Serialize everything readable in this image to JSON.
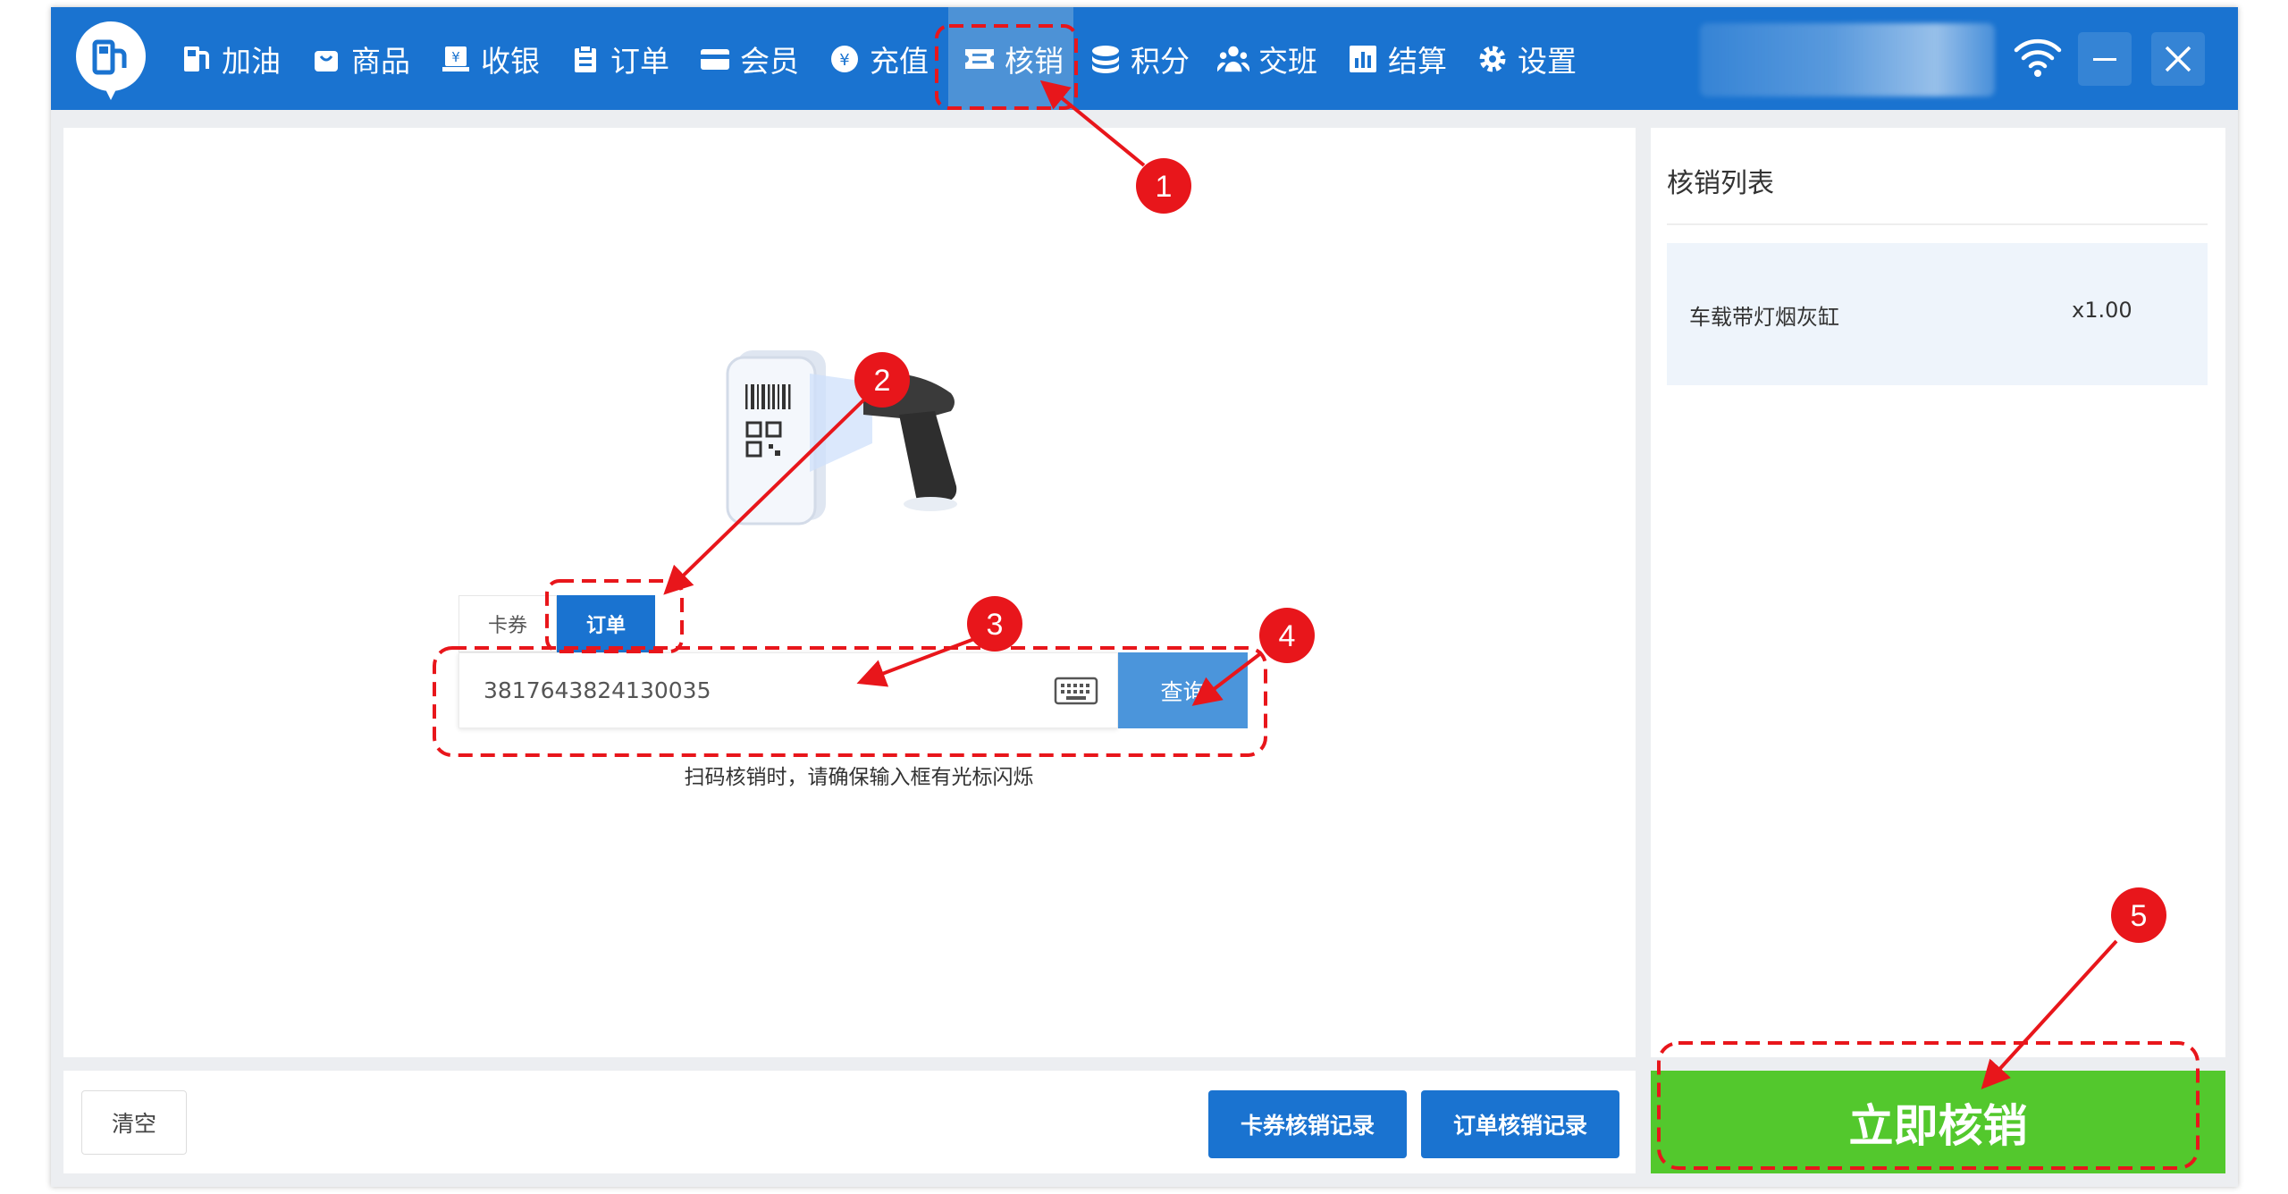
{
  "nav": {
    "items": [
      {
        "label": "加油",
        "icon": "fuel-pump-icon"
      },
      {
        "label": "商品",
        "icon": "shopping-bag-icon"
      },
      {
        "label": "收银",
        "icon": "cash-register-icon"
      },
      {
        "label": "订单",
        "icon": "clipboard-icon"
      },
      {
        "label": "会员",
        "icon": "membership-card-icon"
      },
      {
        "label": "充值",
        "icon": "yen-coin-icon"
      },
      {
        "label": "核销",
        "icon": "ticket-icon",
        "active": true
      },
      {
        "label": "积分",
        "icon": "coins-stack-icon"
      },
      {
        "label": "交班",
        "icon": "users-icon"
      },
      {
        "label": "结算",
        "icon": "bar-chart-icon"
      },
      {
        "label": "设置",
        "icon": "gear-icon"
      }
    ]
  },
  "colors": {
    "primary": "#1a73d0",
    "active_tab": "#4d92d6",
    "confirm": "#53c82d",
    "annotation": "#e8161b"
  },
  "redeem": {
    "tabs": [
      "卡券",
      "订单"
    ],
    "active_tab": "订单",
    "input_value": "3817643824130035",
    "query_label": "查询",
    "hint": "扫码核销时，请确保输入框有光标闪烁"
  },
  "list": {
    "title": "核销列表",
    "items": [
      {
        "name": "车载带灯烟灰缸",
        "qty": "x1.00"
      }
    ]
  },
  "actions": {
    "clear": "清空",
    "coupon_records": "卡券核销记录",
    "order_records": "订单核销记录",
    "confirm": "立即核销"
  },
  "annotations": {
    "steps": [
      "1",
      "2",
      "3",
      "4",
      "5"
    ]
  }
}
